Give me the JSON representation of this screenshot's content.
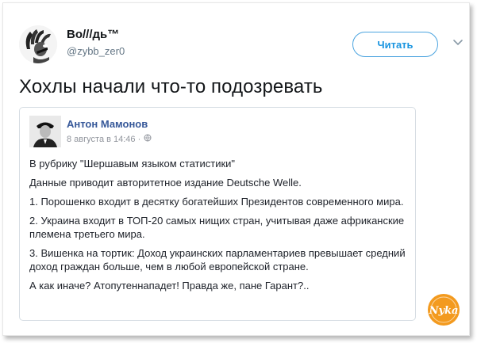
{
  "tweet": {
    "display_name": "Во///дь™",
    "handle": "@zybb_zer0",
    "follow_label": "Читать",
    "text": "Хохлы начали что-то подозревать"
  },
  "quoted_post": {
    "author": "Антон Мамонов",
    "date": "8 августа в 14:46 ·",
    "paragraphs": [
      "В рубрику \"Шершавым языком статистики\"",
      "Данные приводит авторитетное издание Deutsche Welle.",
      "1. Порошенко входит в десятку богатейших Президентов современного мира.",
      "2. Украина входит в ТОП-20 самых нищих стран, учитывая даже африканские племена третьего мира.",
      "3. Вишенка на тортик: Доход украинских парламентариев превышает средний доход граждан больше, чем в любой европейской стране.",
      "А как иначе? Атопутеннападет! Правда же, пане Гарант?.."
    ]
  },
  "watermark": {
    "text": "Nyka",
    "color": "#f39a1e"
  },
  "colors": {
    "accent": "#1b95e0",
    "fb_link": "#365899"
  },
  "icons": [
    "avatar-bird-chief",
    "chevron-down-icon",
    "globe-icon"
  ]
}
